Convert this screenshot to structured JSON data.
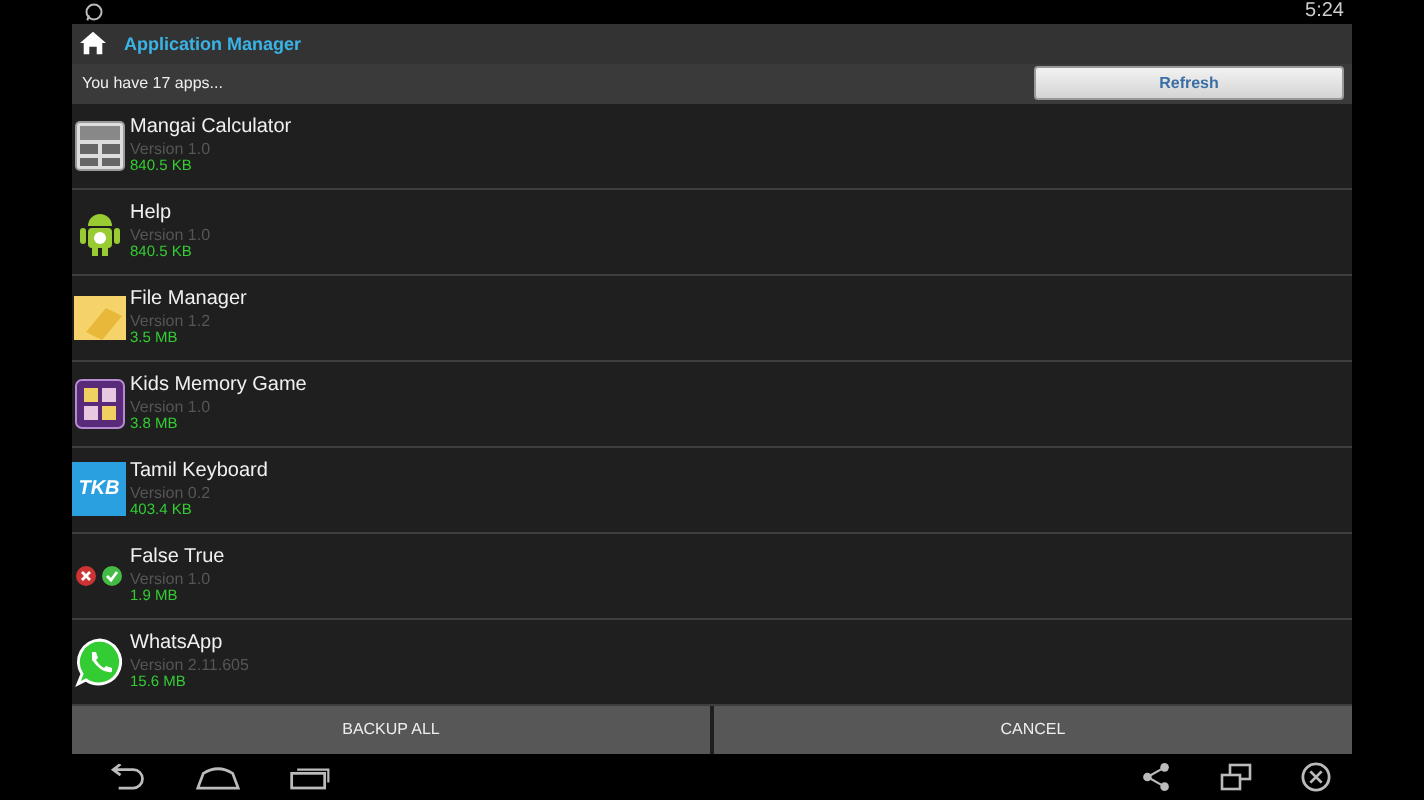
{
  "status_bar": {
    "time": "5:24"
  },
  "action_bar": {
    "title": "Application Manager"
  },
  "info_bar": {
    "message": "You have 17 apps...",
    "button": "Refresh"
  },
  "apps": [
    {
      "name": "Mangai Calculator",
      "version": "Version 1.0",
      "size": "840.5 KB"
    },
    {
      "name": "Help",
      "version": "Version 1.0",
      "size": "840.5 KB"
    },
    {
      "name": "File Manager",
      "version": "Version 1.2",
      "size": "3.5 MB"
    },
    {
      "name": "Kids Memory Game",
      "version": "Version 1.0",
      "size": "3.8 MB"
    },
    {
      "name": "Tamil Keyboard",
      "version": "Version 0.2",
      "size": "403.4 KB",
      "icon_text": "TKB"
    },
    {
      "name": "False True",
      "version": "Version 1.0",
      "size": "1.9 MB"
    },
    {
      "name": "WhatsApp",
      "version": "Version 2.11.605",
      "size": "15.6 MB"
    }
  ],
  "buttons": [
    "BACKUP ALL",
    "CANCEL"
  ]
}
